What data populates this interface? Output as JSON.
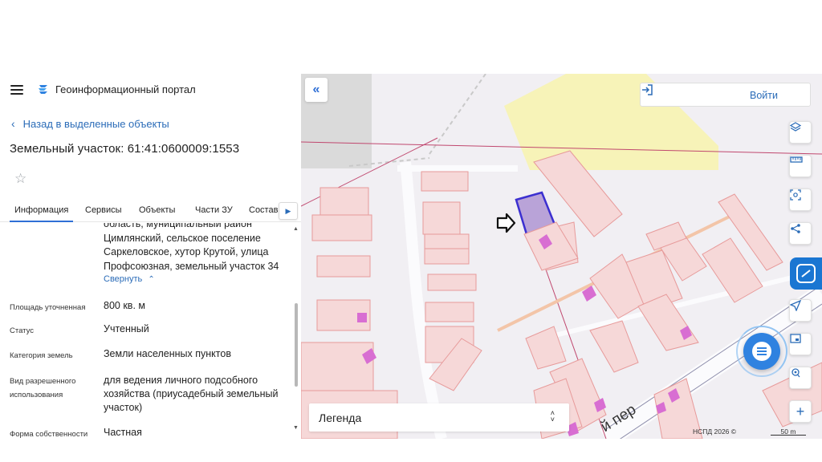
{
  "header": {
    "portal_title": "Геоинформационный портал",
    "menu_icon": "hamburger-menu-icon",
    "logo_icon": "portal-logo-icon"
  },
  "navigation": {
    "back_label": "Назад в выделенные объекты"
  },
  "object": {
    "title": "Земельный участок: 61:41:0600009:1553",
    "favorite_icon": "star-icon"
  },
  "tabs": [
    {
      "label": "Информация",
      "active": true
    },
    {
      "label": "Сервисы",
      "active": false
    },
    {
      "label": "Объекты",
      "active": false
    },
    {
      "label": "Части ЗУ",
      "active": false
    },
    {
      "label": "Состав",
      "active": false
    }
  ],
  "details": {
    "address_lines": [
      "область, муниципальный район",
      "Цимлянский, сельское поселение",
      "Саркеловское, хутор Крутой, улица",
      "Профсоюзная, земельный участок 34"
    ],
    "collapse_label": "Свернуть",
    "rows": [
      {
        "label": "Площадь уточненная",
        "value": "800 кв. м"
      },
      {
        "label": "Статус",
        "value": "Учтенный"
      },
      {
        "label": "Категория земель",
        "value": "Земли населенных пунктов"
      },
      {
        "label": "Вид разрешенного использования",
        "value": "для ведения личного подсобного хозяйства (приусадебный земельный участок)"
      },
      {
        "label": "Форма собственности",
        "value": "Частная"
      }
    ]
  },
  "map": {
    "login_label": "Войти",
    "legend_label": "Легенда",
    "copyright": "НСПД 2026 ©",
    "scale_label": "50 m",
    "street_label": "й пер",
    "colors": {
      "background": "#f1eff3",
      "parcel_fill": "#f6d8d8",
      "parcel_stroke": "#e79a9a",
      "building": "#d86ed2",
      "selected_fill": "#b9a3d8",
      "selected_stroke": "#3b2fd0",
      "accent": "#2f6fd6"
    },
    "tools": [
      "layers-icon",
      "ruler-icon",
      "select-area-icon",
      "share-icon",
      "gosuslugi-icon",
      "locate-icon",
      "picture-in-picture-icon",
      "pin-search-icon",
      "zoom-in-icon"
    ]
  }
}
